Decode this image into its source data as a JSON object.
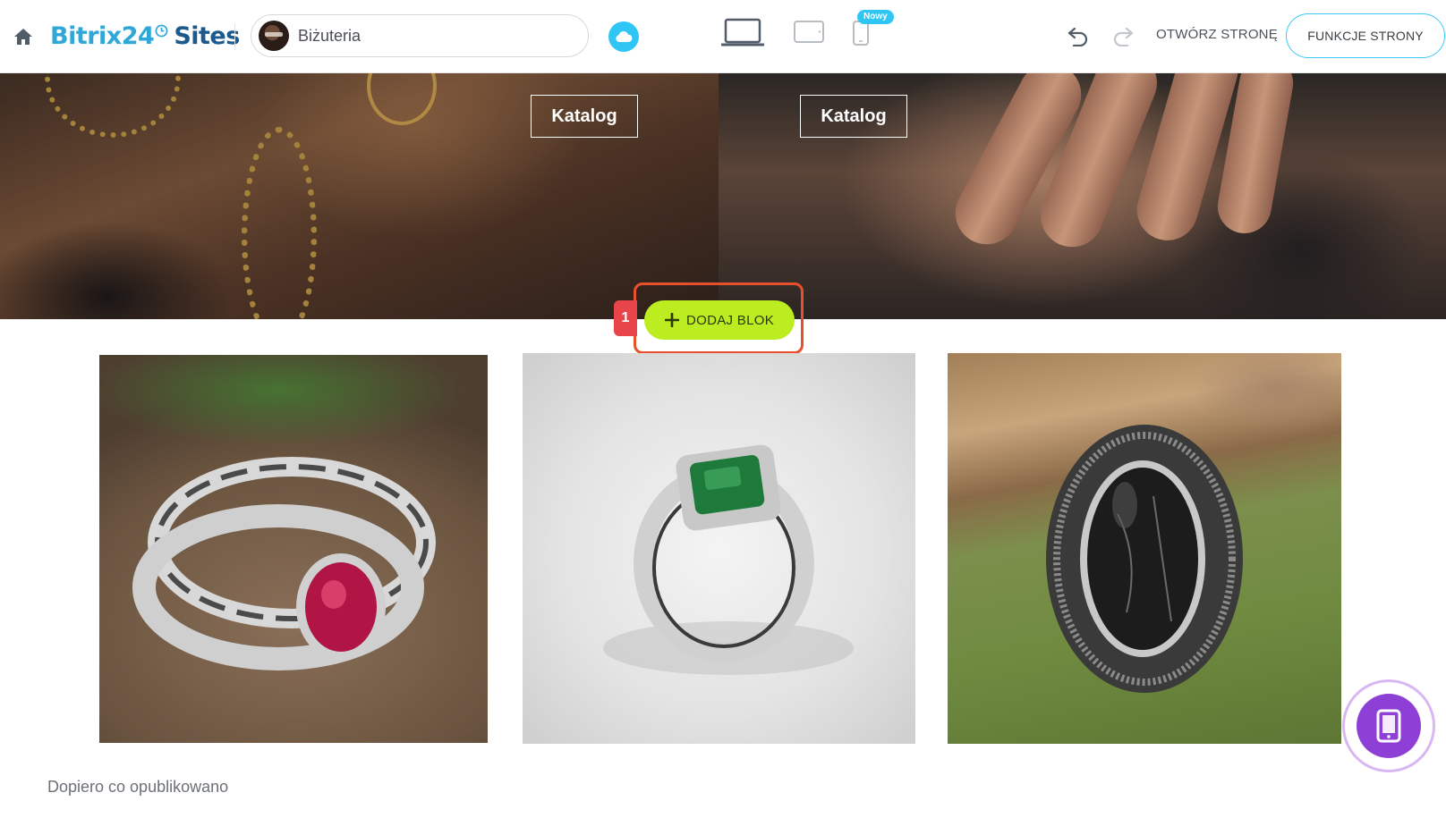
{
  "topbar": {
    "logo_main": "Bitrix24",
    "logo_suffix": "Sites",
    "site_name": "Biżuteria",
    "new_badge": "Nowy",
    "open_page": "OTWÓRZ STRONĘ",
    "page_functions": "FUNKCJE STRONY"
  },
  "hero": {
    "catalog_buttons": [
      "Katalog",
      "Katalog"
    ]
  },
  "add_block": {
    "step_number": "1",
    "label": "DODAJ BLOK"
  },
  "status": {
    "text": "Dopiero co opublikowano"
  },
  "colors": {
    "accent_blue": "#2fc6f6",
    "add_block_green": "#bbed21",
    "highlight_red": "#e8502d",
    "fab_purple": "#8e3fd6"
  },
  "icons": {
    "home": "home-icon",
    "publish": "cloud-icon",
    "desktop": "desktop-icon",
    "tablet": "tablet-icon",
    "mobile": "mobile-icon",
    "undo": "undo-icon",
    "redo": "redo-icon",
    "add": "plus-icon",
    "fab": "mobile-preview-icon"
  }
}
